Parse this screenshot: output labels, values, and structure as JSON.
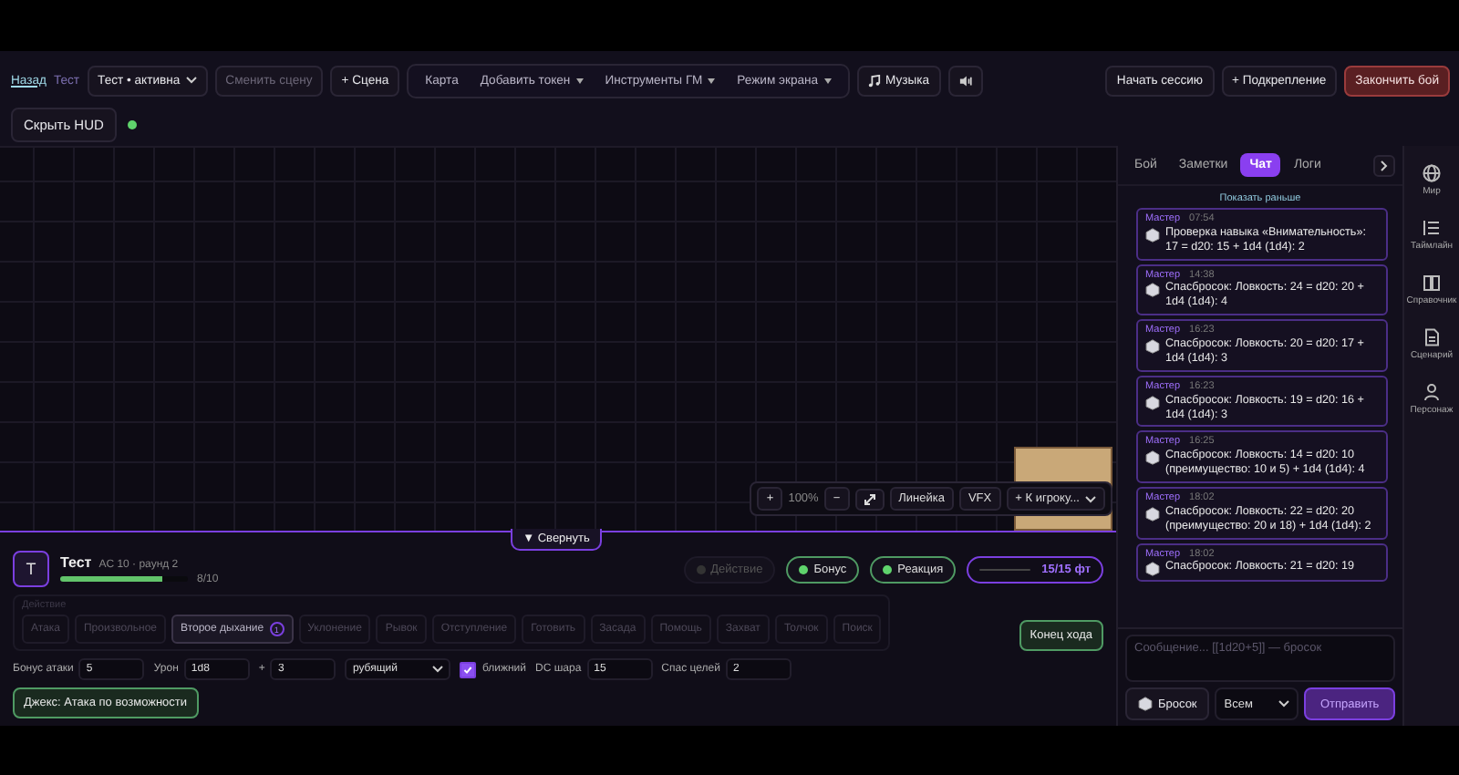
{
  "nav": {
    "back": "Назад",
    "scene_name": "Тест",
    "scene_select": "Тест • активна",
    "change_scene": {
      "label": "Сменить сцену",
      "disabled": true
    },
    "add_scene": "+ Сцена"
  },
  "tool_group": [
    {
      "label": "Карта",
      "dropdown": false
    },
    {
      "label": "Добавить токен",
      "dropdown": true
    },
    {
      "label": "Инструменты ГМ",
      "dropdown": true
    },
    {
      "label": "Режим экрана",
      "dropdown": true
    }
  ],
  "music": "Музыка",
  "session_buttons": [
    {
      "label": "Начать сессию",
      "kind": "normal"
    },
    {
      "label": "+ Подкрепление",
      "kind": "normal"
    },
    {
      "label": "Закончить бой",
      "kind": "danger"
    }
  ],
  "hud": {
    "button": "Скрыть HUD",
    "online": true
  },
  "map_toolbar": {
    "zoom_in": "+",
    "zoom": "100%",
    "zoom_out": "−",
    "ruler": "Линейка",
    "vfx": "VFX",
    "to_player": "+ К игроку..."
  },
  "collapse": "▼ Свернуть",
  "combatant": {
    "initial": "T",
    "name": "Тест",
    "meta": "AC 10 · раунд 2",
    "hp": "8/10",
    "level": 0.8
  },
  "economy": [
    {
      "label": "Действие",
      "available": false
    },
    {
      "label": "Бонус",
      "available": true
    },
    {
      "label": "Реакция",
      "available": true
    }
  ],
  "movement": {
    "reading": "15/15 фт",
    "level": 1
  },
  "actions_label": "Действие",
  "actions": [
    {
      "label": "Атака",
      "available": false
    },
    {
      "label": "Произвольное",
      "available": false
    },
    {
      "label": "Второе дыхание",
      "available": true,
      "badge": "1"
    },
    {
      "label": "Уклонение",
      "available": false
    },
    {
      "label": "Рывок",
      "available": false
    },
    {
      "label": "Отступление",
      "available": false
    },
    {
      "label": "Готовить",
      "available": false
    },
    {
      "label": "Засада",
      "available": false
    },
    {
      "label": "Помощь",
      "available": false
    },
    {
      "label": "Захват",
      "available": false
    },
    {
      "label": "Толчок",
      "available": false
    },
    {
      "label": "Поиск",
      "available": false
    }
  ],
  "end_turn": "Конец хода",
  "fields": [
    {
      "kind": "input",
      "label": "Бонус атаки",
      "value": "5"
    },
    {
      "kind": "input",
      "label": "Урон",
      "value": "1d8"
    },
    {
      "kind": "input",
      "label": "+",
      "value": "3"
    },
    {
      "kind": "select",
      "value": "рубящий"
    },
    {
      "kind": "checkbox",
      "label": "ближний",
      "checked": true
    },
    {
      "kind": "input",
      "label": "DC шара",
      "value": "15"
    },
    {
      "kind": "input",
      "label": "Спас целей",
      "value": "2"
    }
  ],
  "reaction_prompt": "Джекс: Атака по возможности",
  "side_tabs": [
    {
      "label": "Бой",
      "selected": false
    },
    {
      "label": "Заметки",
      "selected": false
    },
    {
      "label": "Чат",
      "selected": true
    },
    {
      "label": "Логи",
      "selected": false
    }
  ],
  "show_earlier": "Показать раньше",
  "messages": [
    {
      "author": "Мастер",
      "time": "07:54",
      "text": "Проверка навыка «Внимательность»: 17 = d20: 15 + 1d4 (1d4): 2"
    },
    {
      "author": "Мастер",
      "time": "14:38",
      "text": "Спасбросок: Ловкость: 24 = d20: 20 + 1d4 (1d4): 4"
    },
    {
      "author": "Мастер",
      "time": "16:23",
      "text": "Спасбросок: Ловкость: 20 = d20: 17 + 1d4 (1d4): 3"
    },
    {
      "author": "Мастер",
      "time": "16:23",
      "text": "Спасбросок: Ловкость: 19 = d20: 16 + 1d4 (1d4): 3"
    },
    {
      "author": "Мастер",
      "time": "16:25",
      "text": "Спасбросок: Ловкость: 14 = d20: 10 (преимущество: 10 и 5) + 1d4 (1d4): 4"
    },
    {
      "author": "Мастер",
      "time": "18:02",
      "text": "Спасбросок: Ловкость: 22 = d20: 20 (преимущество: 20 и 18) + 1d4 (1d4): 2"
    },
    {
      "author": "Мастер",
      "time": "18:02",
      "text": "Спасбросок: Ловкость: 21 = d20: 19"
    }
  ],
  "composer": {
    "placeholder": "Сообщение... [[1d20+5]] — бросок",
    "roll": "Бросок",
    "audience": "Всем",
    "send": "Отправить"
  },
  "rail": [
    {
      "label": "Мир"
    },
    {
      "label": "Таймлайн"
    },
    {
      "label": "Справочник"
    },
    {
      "label": "Сценарий"
    },
    {
      "label": "Персонаж"
    }
  ]
}
